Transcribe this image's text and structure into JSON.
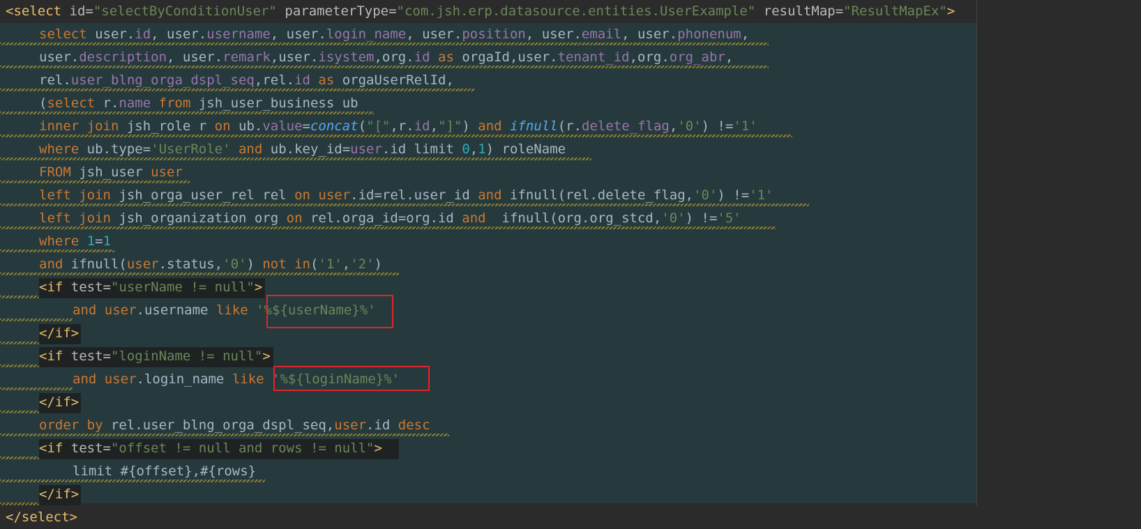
{
  "editor": {
    "language": "xml-mybatis",
    "theme": "dark",
    "highlight_color": "#e0242c"
  },
  "code": {
    "l01": {
      "t1": "<select",
      "a1": " id=",
      "v1": "\"selectByConditionUser\"",
      "a2": " parameterType=",
      "v2": "\"com.jsh.erp.datasource.entities.UserExample\"",
      "a3": " resultMap=",
      "v3": "\"ResultMapEx\"",
      "t2": ">"
    },
    "l02": {
      "k1": "select",
      "p1": " user.",
      "f1": "id",
      "p2": ", user.",
      "f2": "username",
      "p3": ", user.",
      "f3": "login_name",
      "p4": ", user.",
      "f4": "position",
      "p5": ", user.",
      "f5": "email",
      "p6": ", user.",
      "f6": "phonenum",
      "p7": ","
    },
    "l03": {
      "p1": "user.",
      "f1": "description",
      "p2": ", user.",
      "f2": "remark",
      "p3": ",user.",
      "f3": "isystem",
      "p4": ",org.",
      "f4": "id",
      "k1": " as ",
      "p5": "orgaId,user.",
      "f5": "tenant_id",
      "p6": ",org.",
      "f6": "org_abr",
      "p7": ","
    },
    "l04": {
      "p1": "rel.",
      "f1": "user_blng_orga_dspl_seq",
      "p2": ",rel.",
      "f2": "id",
      "k1": " as ",
      "p3": "orgaUserRelId,"
    },
    "l05": {
      "p1": "(",
      "k1": "select",
      "p2": " r.",
      "f1": "name",
      "k2": " from ",
      "p3": "jsh_user_business ub"
    },
    "l06": {
      "k1": "inner join",
      "p1": " jsh_role r ",
      "k2": "on",
      "p2": " ub.",
      "f1": "value",
      "p3": "=",
      "i1": "concat",
      "p4": "(",
      "s1": "\"[\"",
      "p5": ",r.",
      "f2": "id",
      "p6": ",",
      "s2": "\"]\"",
      "p7": ") ",
      "k3": "and",
      "p8": " ",
      "i2": "ifnull",
      "p9": "(r.",
      "f3": "delete_flag",
      "p10": ",",
      "s3": "'0'",
      "p11": ") !=",
      "s4": "'1'"
    },
    "l07": {
      "k1": "where",
      "p1": " ub.type=",
      "s1": "'UserRole'",
      "k2": " and",
      "p2": " ub.key_id=",
      "f1": "user",
      "p3": ".id limit ",
      "n1": "0",
      "p4": ",",
      "n2": "1",
      "p5": ") roleName"
    },
    "l08": {
      "k1": "FROM",
      "p1": " jsh_user ",
      "k2": "user"
    },
    "l09": {
      "k1": "left join",
      "p1": " jsh_orga_user_rel rel ",
      "k2": "on",
      "p2": " ",
      "k3": "user",
      "p3": ".id=rel.user_id ",
      "k4": "and",
      "p4": " ifnull(rel.delete_flag,",
      "s1": "'0'",
      "p5": ") !=",
      "s2": "'1'"
    },
    "l10": {
      "k1": "left join",
      "p1": " jsh_organization org ",
      "k2": "on",
      "p2": " rel.orga_id=org.id ",
      "k3": "and",
      "p3": "  ifnull(org.org_stcd,",
      "s1": "'0'",
      "p4": ") !=",
      "s2": "'5'"
    },
    "l11": {
      "k1": "where",
      "p1": " ",
      "n1": "1",
      "p2": "=",
      "n2": "1"
    },
    "l12": {
      "k1": "and",
      "p1": " ifnull(",
      "k2": "user",
      "p2": ".status,",
      "s1": "'0'",
      "p3": ") ",
      "k3": "not in",
      "p4": "(",
      "s2": "'1'",
      "p5": ",",
      "s3": "'2'",
      "p6": ")"
    },
    "l13": {
      "t1": "<if",
      "a1": " test=",
      "v1": "\"userName != null\"",
      "t2": ">"
    },
    "l14": {
      "k1": "and",
      "p1": " ",
      "k2": "user",
      "p2": ".username ",
      "k3": "like",
      "p3": " ",
      "s1": "'%${userName}%'"
    },
    "l15": {
      "t1": "</if>"
    },
    "l16": {
      "t1": "<if",
      "a1": " test=",
      "v1": "\"loginName != null\"",
      "t2": ">"
    },
    "l17": {
      "k1": "and",
      "p1": " ",
      "k2": "user",
      "p2": ".login_name ",
      "k3": "like",
      "p3": " ",
      "s1": "'%${loginName}%'"
    },
    "l18": {
      "t1": "</if>"
    },
    "l19": {
      "k1": "order by",
      "p1": " rel.user_blng_orga_dspl_seq,",
      "k2": "user",
      "p2": ".id ",
      "k3": "desc"
    },
    "l20": {
      "t1": "<if",
      "a1": " test=",
      "v1": "\"offset != null and rows != null\"",
      "t2": ">"
    },
    "l21": {
      "p1": "limit #{offset},#{rows}"
    },
    "l22": {
      "t1": "</if>"
    },
    "l23": {
      "t1": "</select>"
    }
  }
}
